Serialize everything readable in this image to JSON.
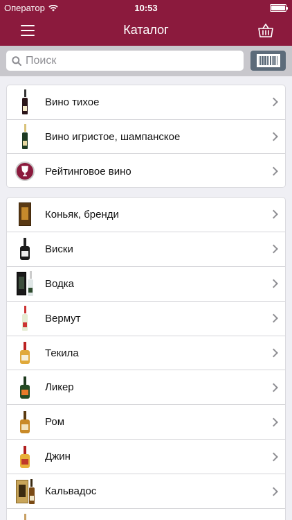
{
  "status": {
    "carrier": "Оператор",
    "time": "10:53"
  },
  "header": {
    "title": "Каталог",
    "menu_icon": "menu-icon",
    "cart_icon": "basket-icon"
  },
  "search": {
    "placeholder": "Поиск",
    "value": "",
    "scan_icon": "barcode-icon"
  },
  "colors": {
    "brand": "#8b1a3d",
    "scan_button": "#5c6b7a",
    "background": "#efeff4"
  },
  "groups": [
    {
      "items": [
        {
          "label": "Вино тихое",
          "icon": "red-wine-bottle-icon"
        },
        {
          "label": "Вино игристое, шампанское",
          "icon": "sparkling-wine-bottle-icon"
        },
        {
          "label": "Рейтинговое вино",
          "icon": "wine-rating-badge-icon"
        }
      ]
    },
    {
      "items": [
        {
          "label": "Коньяк, бренди",
          "icon": "cognac-box-icon"
        },
        {
          "label": "Виски",
          "icon": "whisky-bottle-icon"
        },
        {
          "label": "Водка",
          "icon": "vodka-bottle-icon"
        },
        {
          "label": "Вермут",
          "icon": "vermouth-bottle-icon"
        },
        {
          "label": "Текила",
          "icon": "tequila-bottle-icon"
        },
        {
          "label": "Ликер",
          "icon": "liqueur-bottle-icon"
        },
        {
          "label": "Ром",
          "icon": "rum-bottle-icon"
        },
        {
          "label": "Джин",
          "icon": "gin-bottle-icon"
        },
        {
          "label": "Кальвадос",
          "icon": "calvados-box-icon"
        },
        {
          "label": "",
          "icon": "bottle-icon"
        }
      ]
    }
  ]
}
